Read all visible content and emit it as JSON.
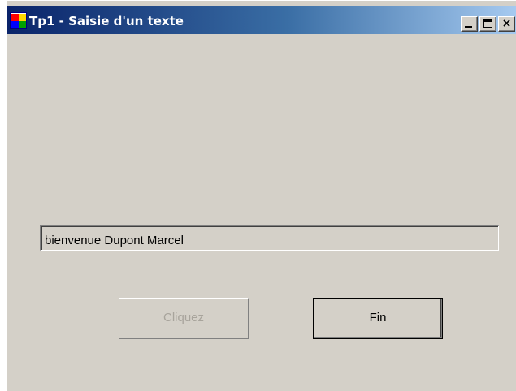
{
  "window": {
    "title": "Tp1 - Saisie d'un texte",
    "icon": "app-form-icon",
    "controls": {
      "minimize_icon": "minimize-icon",
      "maximize_icon": "maximize-icon",
      "close_icon": "close-icon",
      "close_glyph": "×"
    },
    "colors": {
      "titlebar_start": "#0a246a",
      "titlebar_end": "#a6caf0",
      "client_background": "#d4d0c8"
    }
  },
  "form": {
    "text_field": {
      "value": "bienvenue Dupont Marcel"
    },
    "buttons": {
      "cliquez_label": "Cliquez",
      "cliquez_state": "disabled",
      "fin_label": "Fin",
      "fin_state": "default"
    }
  }
}
